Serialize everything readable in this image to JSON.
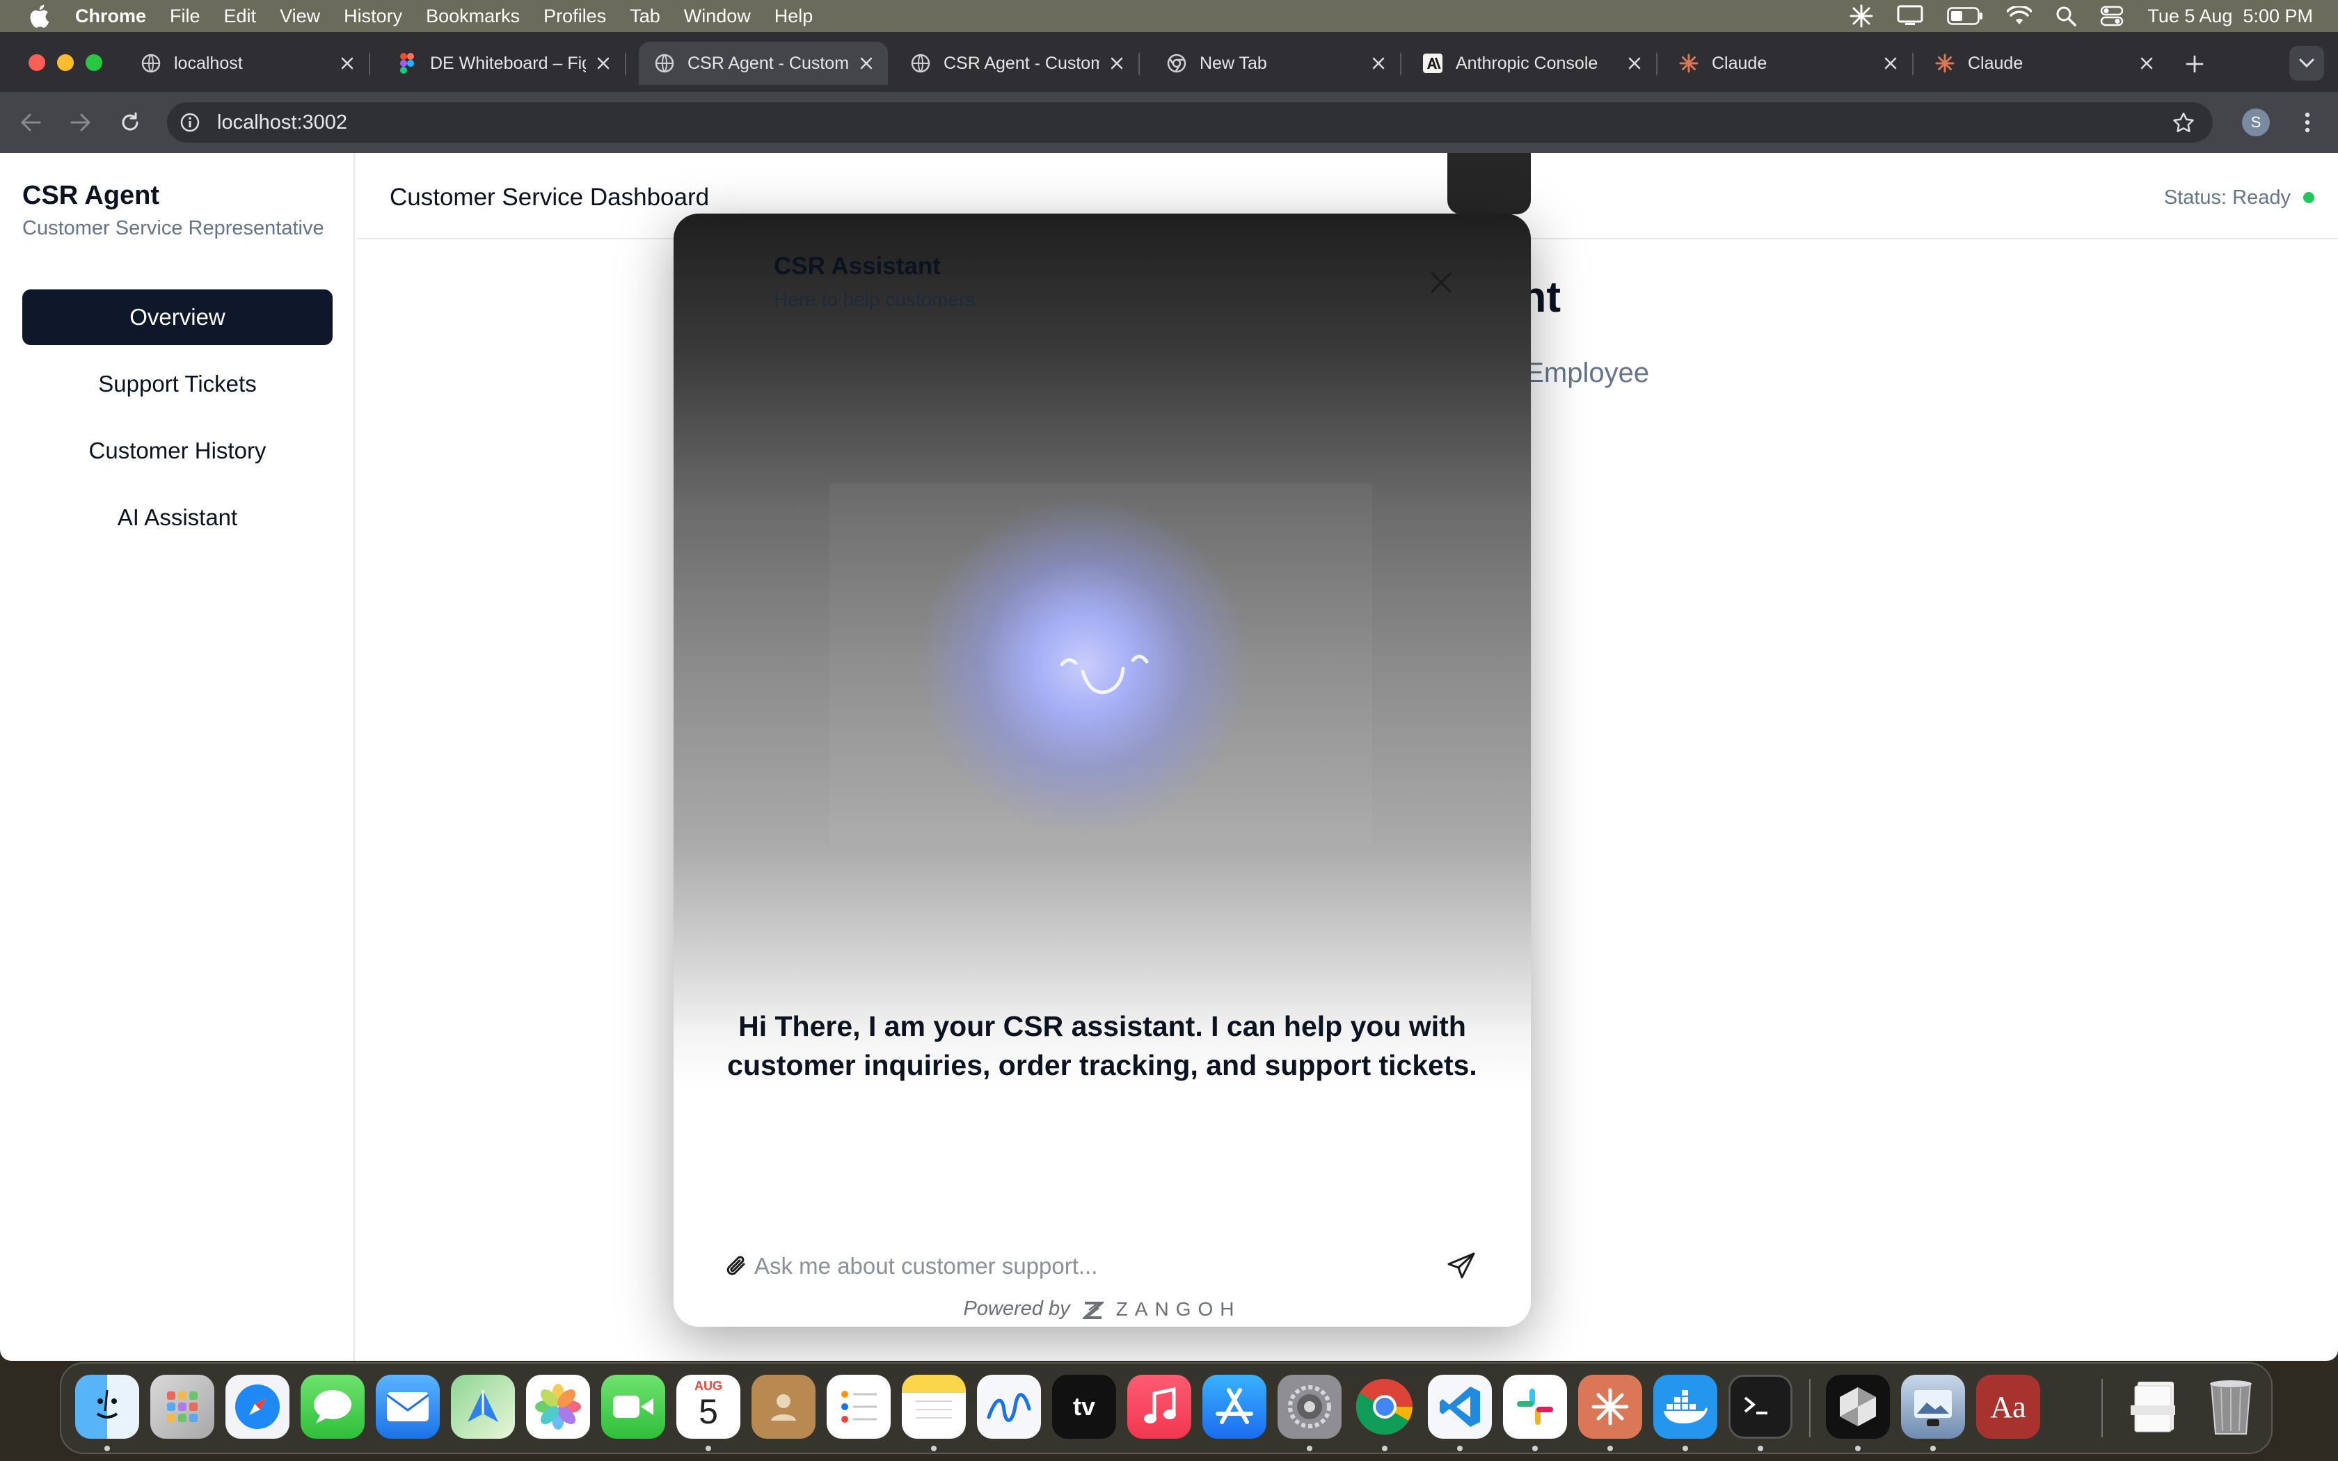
{
  "menubar": {
    "app": "Chrome",
    "menus": [
      "File",
      "Edit",
      "View",
      "History",
      "Bookmarks",
      "Profiles",
      "Tab",
      "Window",
      "Help"
    ],
    "clock": "Tue 5 Aug  5:00 PM"
  },
  "tabs": [
    {
      "title": "localhost",
      "icon": "globe-icon"
    },
    {
      "title": "DE Whiteboard – Figma",
      "icon": "figma-icon"
    },
    {
      "title": "CSR Agent - Customer Service",
      "icon": "globe-icon",
      "active": true
    },
    {
      "title": "CSR Agent - Customer Service",
      "icon": "globe-icon"
    },
    {
      "title": "New Tab",
      "icon": "chrome-icon"
    },
    {
      "title": "Anthropic Console",
      "icon": "anthropic-icon"
    },
    {
      "title": "Claude",
      "icon": "claude-icon"
    },
    {
      "title": "Claude",
      "icon": "claude-icon"
    }
  ],
  "address_bar": {
    "url": "localhost:3002",
    "profile_initial": "S"
  },
  "sidebar": {
    "brand": "CSR Agent",
    "subtitle": "Customer Service Representative",
    "items": [
      {
        "label": "Overview",
        "active": true
      },
      {
        "label": "Support Tickets"
      },
      {
        "label": "Customer History"
      },
      {
        "label": "AI Assistant"
      }
    ]
  },
  "header": {
    "title": "Customer Service Dashboard",
    "status": "Status: Ready",
    "status_color": "#22c55e"
  },
  "background_content": {
    "heading_fragment": "ent",
    "subheading_fragment": "al Employee"
  },
  "chat_modal": {
    "title": "CSR Assistant",
    "subtitle": "Here to help customers",
    "greeting": "Hi There, I am your CSR assistant. I can help you with customer inquiries, order tracking, and support tickets.",
    "input_placeholder": "Ask me about customer support...",
    "powered_by": "Powered by",
    "brand": "ZANGOH"
  },
  "dock": {
    "calendar_month": "AUG",
    "calendar_day": "5",
    "tv_label": "tv",
    "dictionary_label": "Aa"
  },
  "colors": {
    "accent": "#0f172a",
    "orb": "#a6aef5",
    "status": "#22c55e"
  }
}
